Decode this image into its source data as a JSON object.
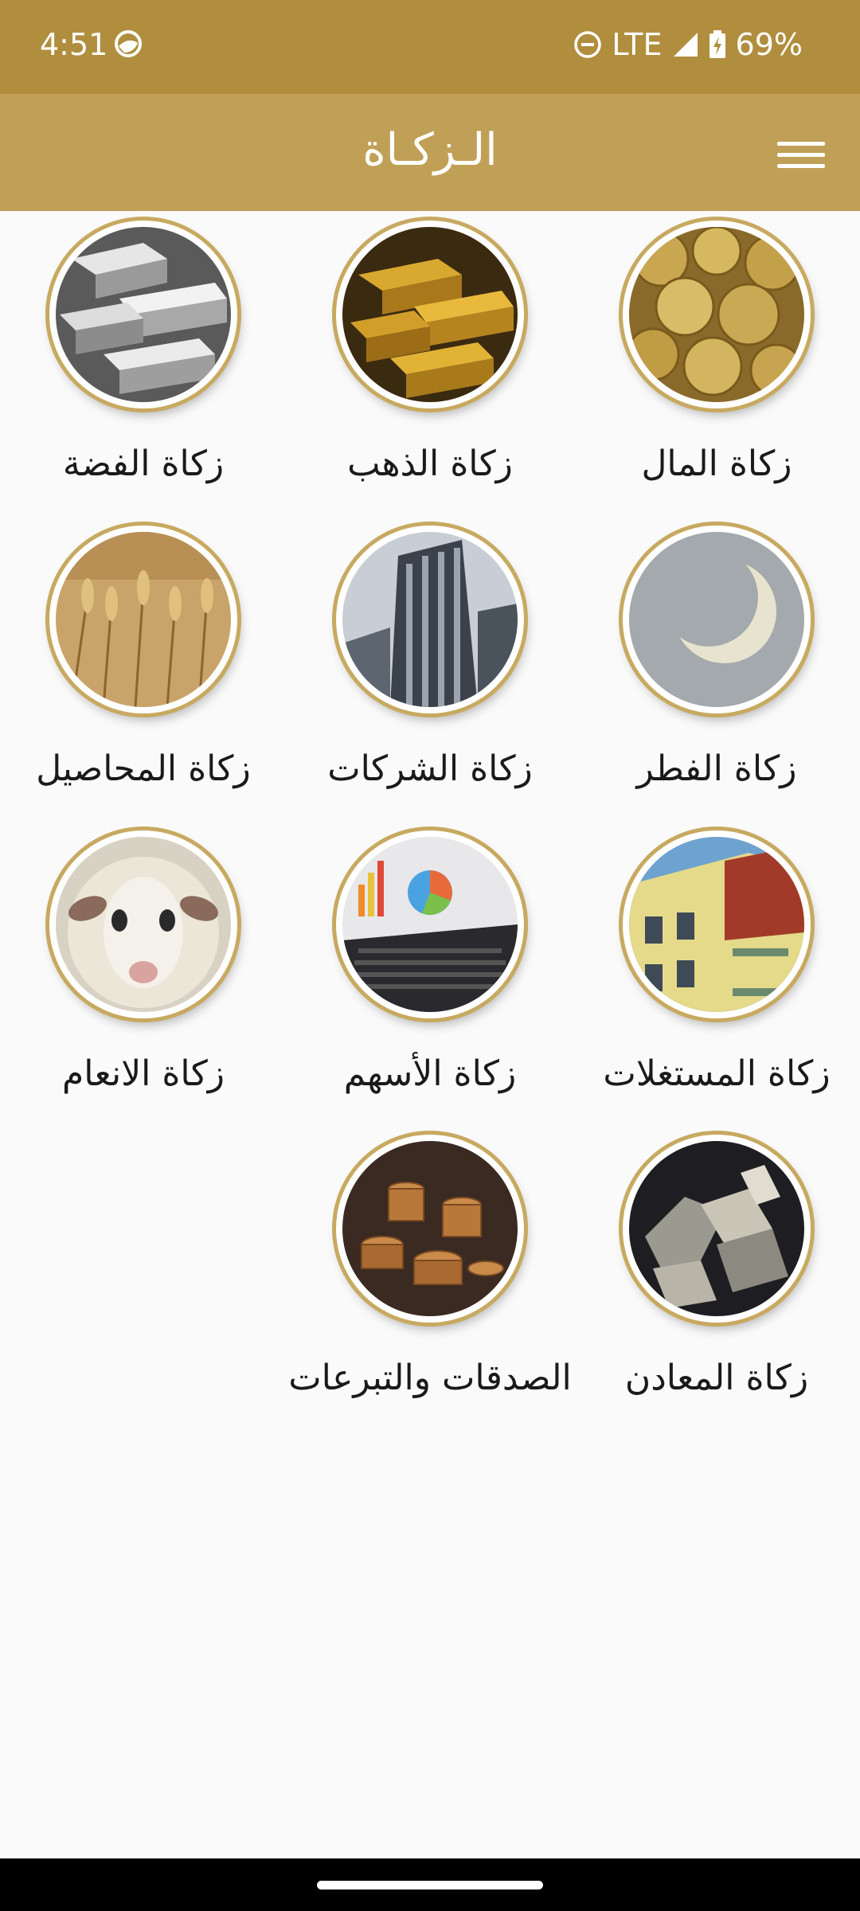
{
  "status_bar": {
    "time": "4:51",
    "network": "LTE",
    "battery": "69%"
  },
  "app_bar": {
    "title": "الـزكـاة",
    "menu_icon": "hamburger-menu-icon"
  },
  "tiles": [
    {
      "label": "زكاة المال",
      "image": "coins-image"
    },
    {
      "label": "زكاة الذهب",
      "image": "gold-bars-image"
    },
    {
      "label": "زكاة الفضة",
      "image": "silver-bars-image"
    },
    {
      "label": "زكاة الفطر",
      "image": "crescent-moon-image"
    },
    {
      "label": "زكاة الشركات",
      "image": "skyscraper-image"
    },
    {
      "label": "زكاة المحاصيل",
      "image": "wheat-field-image"
    },
    {
      "label": "زكاة المستغلات",
      "image": "apartment-building-image"
    },
    {
      "label": "زكاة الأسهم",
      "image": "laptop-charts-image"
    },
    {
      "label": "زكاة الانعام",
      "image": "sheep-image"
    },
    {
      "label": "زكاة المعادن",
      "image": "minerals-image"
    },
    {
      "label": "الصدقات والتبرعات",
      "image": "coin-stacks-image"
    }
  ],
  "colors": {
    "status_bar": "#b08e3e",
    "app_bar": "#c0a057",
    "ring": "#c7a960",
    "background": "#fafafa"
  }
}
